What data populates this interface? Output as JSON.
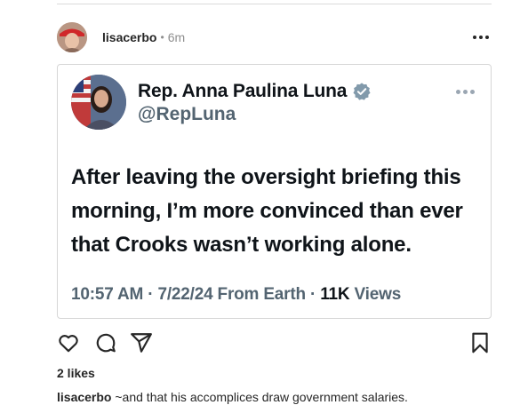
{
  "post": {
    "username": "lisacerbo",
    "separator": "•",
    "time_ago": "6m",
    "more_icon": "more-horizontal-icon"
  },
  "tweet": {
    "display_name": "Rep. Anna Paulina Luna",
    "handle": "@RepLuna",
    "text": "After leaving the oversight briefing this morning, I’m more convinced than ever that Crooks wasn’t working alone.",
    "time": "10:57 AM",
    "date": "7/22/24",
    "source": "From Earth",
    "views_count": "11K",
    "views_label": "Views",
    "sep": "·",
    "verified_color": "#829aab"
  },
  "actions": {
    "icons": [
      "heart-icon",
      "comment-icon",
      "share-icon",
      "bookmark-icon"
    ]
  },
  "likes": "2 likes",
  "caption": {
    "username": "lisacerbo",
    "text": "~and that his accomplices draw government salaries."
  }
}
